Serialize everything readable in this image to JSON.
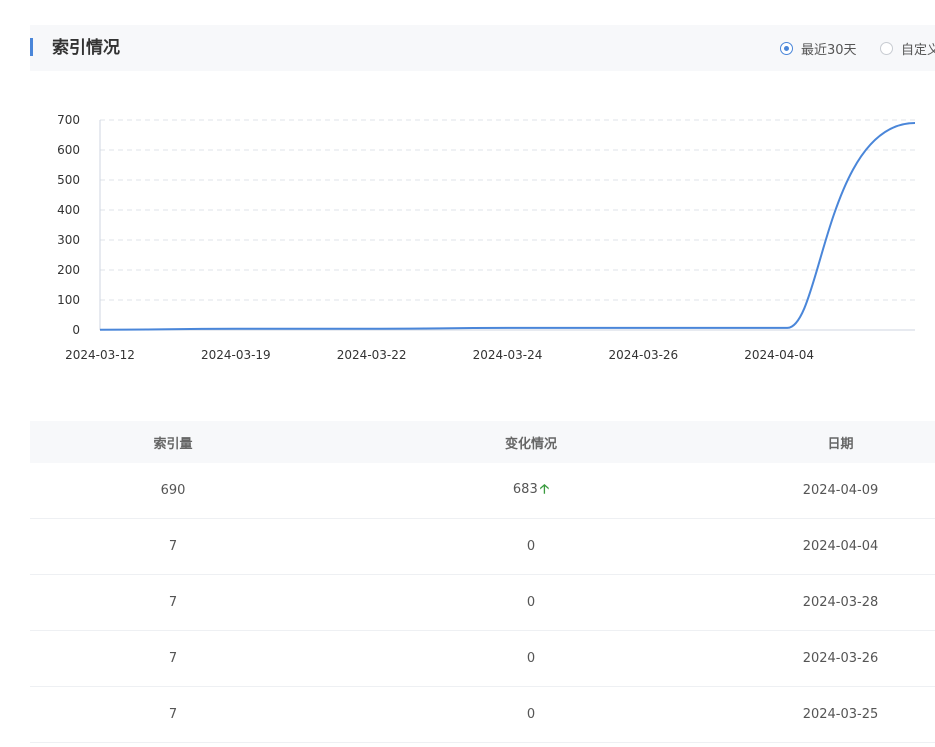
{
  "header": {
    "title": "索引情况",
    "range_options": [
      {
        "label": "最近30天",
        "checked": true
      },
      {
        "label": "自定义",
        "checked": false
      }
    ]
  },
  "chart_data": {
    "type": "line",
    "categories": [
      "2024-03-12",
      "2024-03-19",
      "2024-03-22",
      "2024-03-24",
      "2024-03-26",
      "2024-04-04",
      "2024-04-09"
    ],
    "x_tick_labels": [
      "2024-03-12",
      "2024-03-19",
      "2024-03-22",
      "2024-03-24",
      "2024-03-26",
      "2024-04-04"
    ],
    "series": [
      {
        "values": [
          1,
          4,
          4,
          7,
          7,
          7,
          690
        ],
        "color": "#4a86d9"
      }
    ],
    "y_ticks": [
      0,
      100,
      200,
      300,
      400,
      500,
      600,
      700
    ],
    "ylim": [
      0,
      700
    ],
    "grid": true
  },
  "table": {
    "headers": [
      "索引量",
      "变化情况",
      "日期"
    ],
    "rows": [
      {
        "count": "690",
        "change": "683",
        "trend": "up",
        "date": "2024-04-09"
      },
      {
        "count": "7",
        "change": "0",
        "trend": "",
        "date": "2024-04-04"
      },
      {
        "count": "7",
        "change": "0",
        "trend": "",
        "date": "2024-03-28"
      },
      {
        "count": "7",
        "change": "0",
        "trend": "",
        "date": "2024-03-26"
      },
      {
        "count": "7",
        "change": "0",
        "trend": "",
        "date": "2024-03-25"
      }
    ]
  },
  "icons": {
    "trend_up": "arrow-up-icon"
  },
  "colors": {
    "accent": "#4a86d9",
    "up": "#3a9b3f"
  }
}
